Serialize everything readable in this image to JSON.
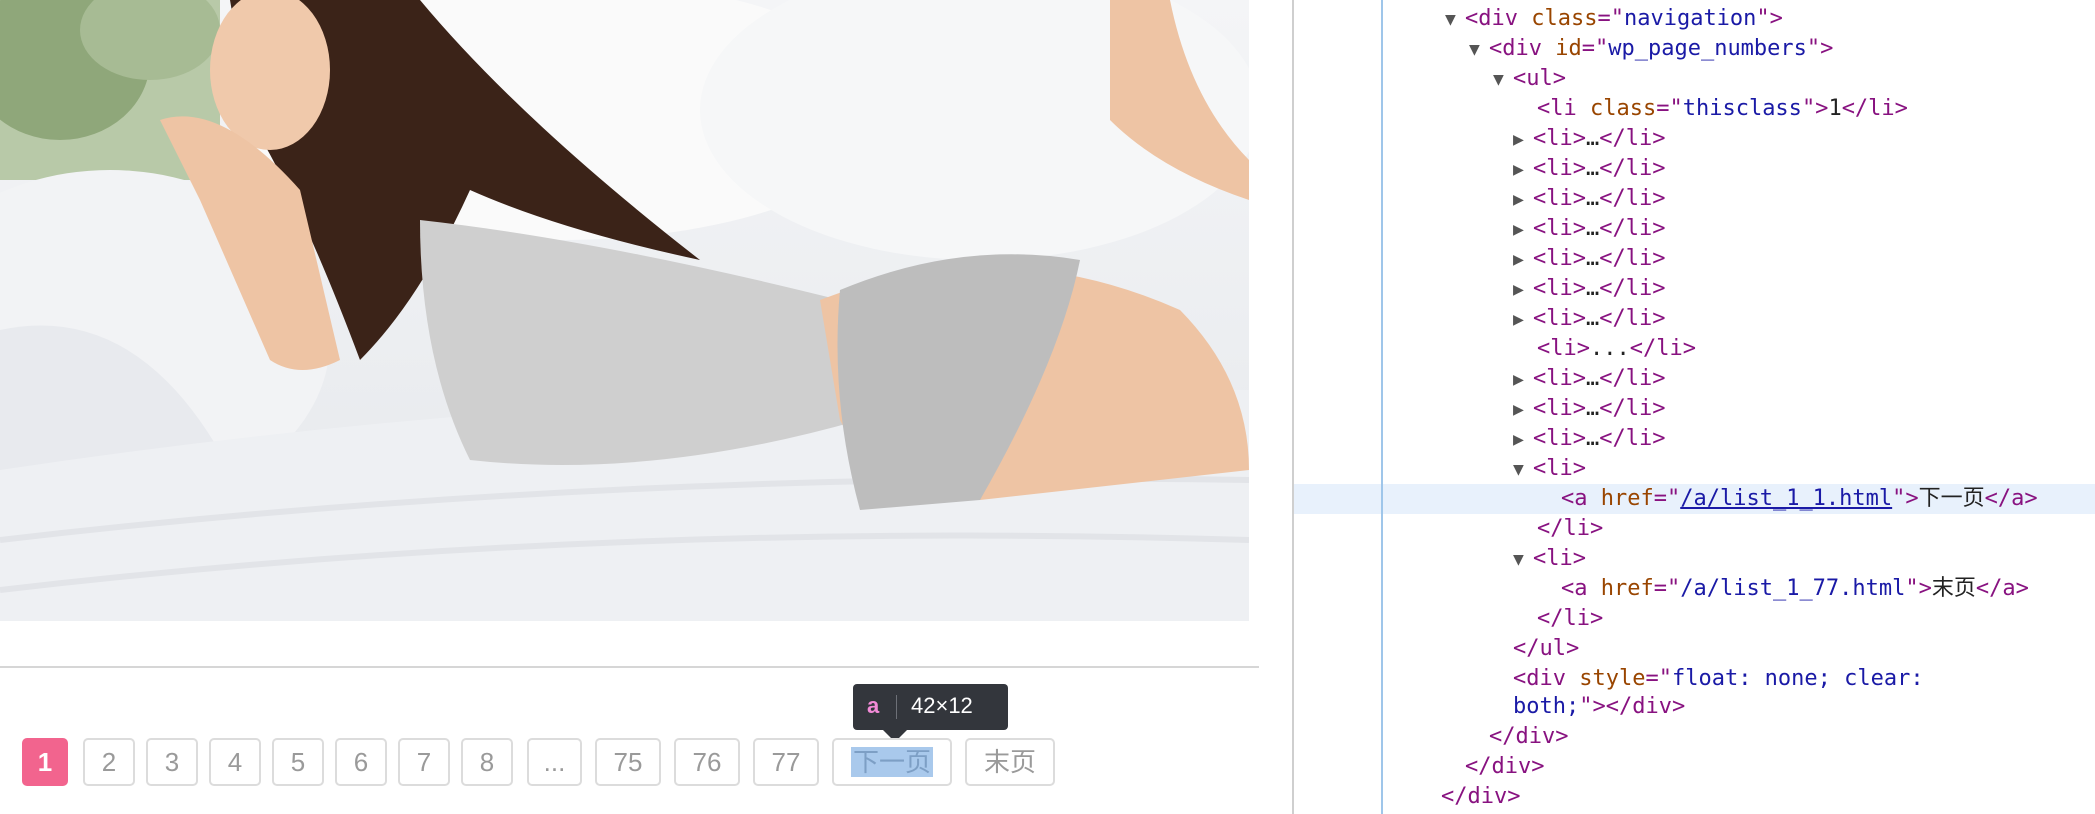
{
  "pagination": {
    "items": [
      "1",
      "2",
      "3",
      "4",
      "5",
      "6",
      "7",
      "8",
      "...",
      "75",
      "76",
      "77",
      "下一页",
      "末页"
    ],
    "active": "1"
  },
  "tooltip": {
    "tag": "a",
    "dimensions": "42×12"
  },
  "devtools": {
    "navigation_class": "navigation",
    "page_numbers_id": "wp_page_numbers",
    "thisclass": "thisclass",
    "first_li_text": "1",
    "collapsed_li": "…",
    "dots_li": "...",
    "next_href": "/a/list_1_1.html",
    "next_text": "下一页",
    "last_href": "/a/list_1_77.html",
    "last_text": "末页",
    "clear_style_1": "float: none; clear:",
    "clear_style_2": "both;"
  }
}
